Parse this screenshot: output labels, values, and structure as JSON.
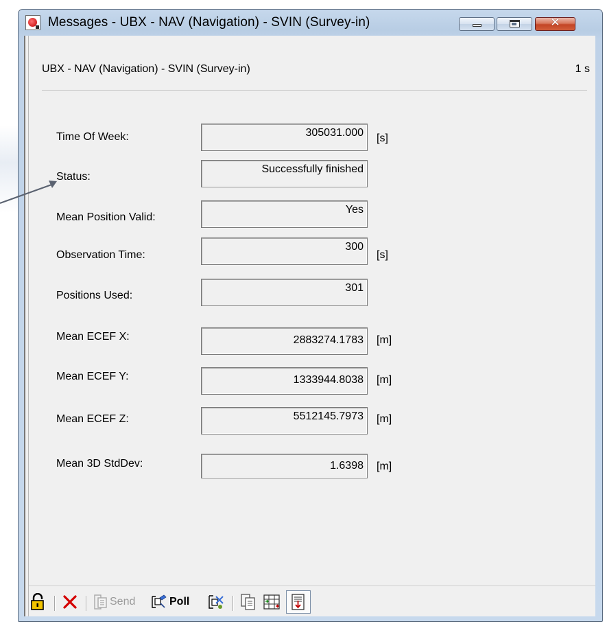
{
  "window": {
    "title": "Messages - UBX - NAV (Navigation) - SVIN (Survey-in)",
    "controls": {
      "minimize_icon": "minimize-icon",
      "maximize_icon": "maximize-icon",
      "close_icon": "close-icon"
    }
  },
  "header": {
    "title": "UBX - NAV (Navigation) - SVIN (Survey-in)",
    "rate": "1 s"
  },
  "fields": [
    {
      "label": "Time Of Week:",
      "value": "305031.000",
      "unit": "[s]"
    },
    {
      "label": "Status:",
      "value": "Successfully finished",
      "unit": ""
    },
    {
      "label": "Mean Position Valid:",
      "value": "Yes",
      "unit": ""
    },
    {
      "label": "Observation Time:",
      "value": "300",
      "unit": "[s]"
    },
    {
      "label": "Positions Used:",
      "value": "301",
      "unit": ""
    },
    {
      "label": "Mean ECEF X:",
      "value": "2883274.1783",
      "unit": "[m]"
    },
    {
      "label": "Mean ECEF Y:",
      "value": "1333944.8038",
      "unit": "[m]"
    },
    {
      "label": "Mean ECEF Z:",
      "value": "5512145.7973",
      "unit": "[m]"
    },
    {
      "label": "Mean 3D StdDev:",
      "value": "1.6398",
      "unit": "[m]"
    }
  ],
  "toolbar": {
    "send_label": "Send",
    "poll_label": "Poll",
    "icons": [
      "lock-open-icon",
      "delete-icon",
      "send-icon",
      "poll-icon",
      "poll-config-icon",
      "copy-icon",
      "columns-icon",
      "autoscroll-icon"
    ]
  },
  "colors": {
    "title_bar": "#bfd2e8",
    "close_button": "#c34526",
    "client_bg": "#f0f0f0",
    "delete_red": "#d40000",
    "lock_yellow": "#f2c400",
    "arrow": "#5a6270"
  }
}
